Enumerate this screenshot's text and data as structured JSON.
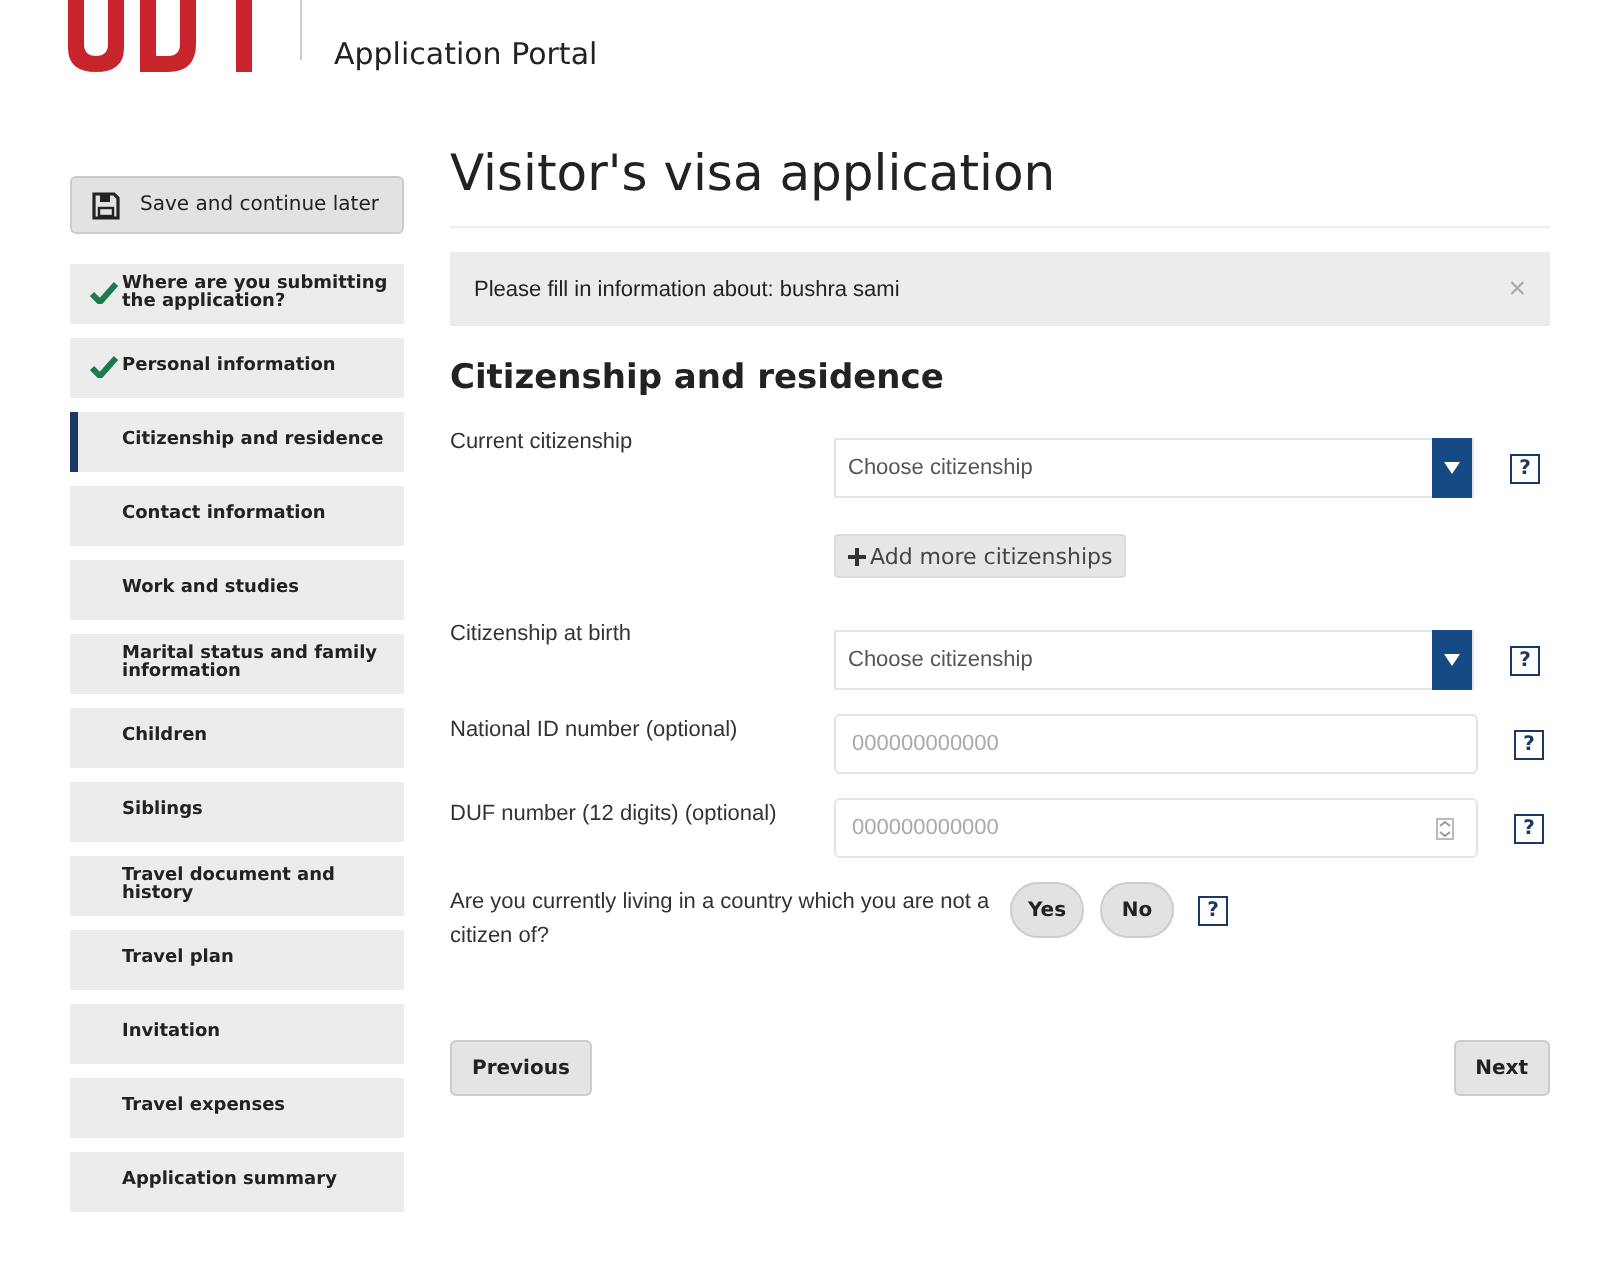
{
  "header": {
    "portal_title": "Application Portal"
  },
  "save_button": "Save and continue later",
  "steps": [
    {
      "label": "Where are you submitting the application?",
      "done": true,
      "selected": false
    },
    {
      "label": "Personal information",
      "done": true,
      "selected": false
    },
    {
      "label": "Citizenship and residence",
      "done": false,
      "selected": true
    },
    {
      "label": "Contact information",
      "done": false,
      "selected": false
    },
    {
      "label": "Work and studies",
      "done": false,
      "selected": false
    },
    {
      "label": "Marital status and family information",
      "done": false,
      "selected": false
    },
    {
      "label": "Children",
      "done": false,
      "selected": false
    },
    {
      "label": "Siblings",
      "done": false,
      "selected": false
    },
    {
      "label": "Travel document and history",
      "done": false,
      "selected": false
    },
    {
      "label": "Travel plan",
      "done": false,
      "selected": false
    },
    {
      "label": "Invitation",
      "done": false,
      "selected": false
    },
    {
      "label": "Travel expenses",
      "done": false,
      "selected": false
    },
    {
      "label": "Application summary",
      "done": false,
      "selected": false
    }
  ],
  "page_title": "Visitor's visa application",
  "notice": {
    "text": "Please fill in information about: bushra sami",
    "close": "×"
  },
  "section_title": "Citizenship and residence",
  "fields": [
    {
      "kind": "select",
      "label": "Current citizenship",
      "placeholder": "Choose citizenship",
      "help": "?",
      "extra_button": "Add more citizenships"
    },
    {
      "kind": "select",
      "label": "Citizenship at birth",
      "placeholder": "Choose citizenship",
      "help": "?"
    },
    {
      "kind": "text",
      "label": "National ID number (optional)",
      "placeholder": "000000000000",
      "help": "?"
    },
    {
      "kind": "number",
      "label": "DUF number (12 digits) (optional)",
      "placeholder": "000000000000",
      "help": "?"
    },
    {
      "kind": "yesno",
      "label": "Are you currently living in a country which you are not a citizen of?",
      "options": [
        "Yes",
        "No"
      ],
      "help": "?"
    }
  ],
  "nav": {
    "previous": "Previous",
    "next": "Next"
  }
}
